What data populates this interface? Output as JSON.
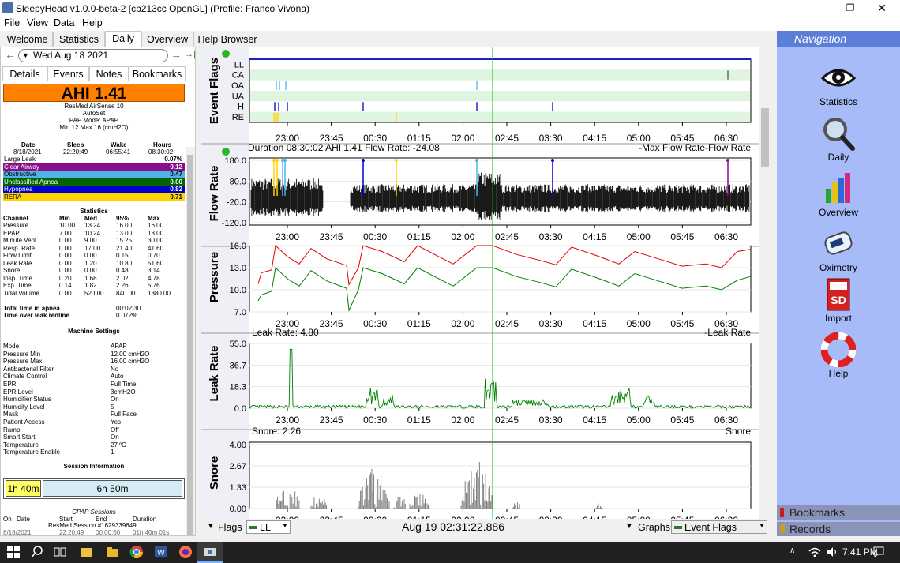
{
  "window": {
    "title": "SleepyHead v1.0.0-beta-2 [cb213cc OpenGL] (Profile: Franco Vivona)",
    "minimize": "—",
    "maximize": "❐",
    "close": "✕"
  },
  "menu": [
    "File",
    "View",
    "Data",
    "Help"
  ],
  "tabs": [
    "Welcome",
    "Statistics",
    "Daily",
    "Overview",
    "Help Browser"
  ],
  "date_nav": {
    "date": "Wed Aug 18 2021",
    "prev": "←",
    "next": "→",
    "last": "→|"
  },
  "subtabs": [
    "Details",
    "Events",
    "Notes",
    "Bookmarks"
  ],
  "ahi": "AHI 1.41",
  "machine": {
    "name": "ResMed AirSense 10",
    "model": "AutoSet",
    "mode": "PAP Mode: APAP",
    "pressure": "Min 12 Max 16 (cmH2O)"
  },
  "session_header": {
    "cols": [
      "Date",
      "Sleep",
      "Wake",
      "Hours"
    ],
    "vals": [
      "8/18/2021",
      "22:20:49",
      "06:55:41",
      "08:30:02"
    ]
  },
  "event_rows": [
    {
      "label": "Large Leak",
      "value": "0.07%",
      "color": "#ffffff",
      "text": "#000000"
    },
    {
      "label": "Clear Airway",
      "value": "0.12",
      "color": "#8a0f8a",
      "text": "#ffffff"
    },
    {
      "label": "Obstructive",
      "value": "0.47",
      "color": "#4fb3e8",
      "text": "#000000"
    },
    {
      "label": "Unclassified Apnea",
      "value": "0.00",
      "color": "#006400",
      "text": "#ffffff"
    },
    {
      "label": "Hypopnea",
      "value": "0.82",
      "color": "#0000cc",
      "text": "#ffffff"
    },
    {
      "label": "RERA",
      "value": "0.71",
      "color": "#ffd400",
      "text": "#000000"
    }
  ],
  "statistics": {
    "title": "Statistics",
    "cols": [
      "Channel",
      "Min",
      "Med",
      "95%",
      "Max"
    ],
    "rows": [
      [
        "Pressure",
        "10.00",
        "13.24",
        "16.00",
        "16.00"
      ],
      [
        "EPAP",
        "7.00",
        "10.24",
        "13.00",
        "13.00"
      ],
      [
        "Minute Vent.",
        "0.00",
        "9.00",
        "15.25",
        "30.00"
      ],
      [
        "Resp. Rate",
        "0.00",
        "17.00",
        "21.40",
        "41.60"
      ],
      [
        "Flow Limit.",
        "0.00",
        "0.00",
        "0.15",
        "0.70"
      ],
      [
        "Leak Rate",
        "0.00",
        "1.20",
        "10.80",
        "51.60"
      ],
      [
        "Snore",
        "0.00",
        "0.00",
        "0.48",
        "3.14"
      ],
      [
        "Insp. Time",
        "0.20",
        "1.68",
        "2.02",
        "4.78"
      ],
      [
        "Exp. Time",
        "0.14",
        "1.82",
        "2.26",
        "5.76"
      ],
      [
        "Tidal Volume",
        "0.00",
        "520.00",
        "840.00",
        "1380.00"
      ]
    ]
  },
  "apnea": [
    {
      "label": "Total time in apnea",
      "value": "00:02:30"
    },
    {
      "label": "Time over leak redline",
      "value": "0.072%"
    }
  ],
  "machine_settings": {
    "title": "Machine Settings",
    "rows": [
      [
        "Mode",
        "APAP"
      ],
      [
        "Pressure Min",
        "12.00 cmH2O"
      ],
      [
        "Pressure Max",
        "16.00 cmH2O"
      ],
      [
        "Antibacterial Filter",
        "No"
      ],
      [
        "Climate Control",
        "Auto"
      ],
      [
        "EPR",
        "Full Time"
      ],
      [
        "EPR Level",
        "3cmH2O"
      ],
      [
        "Humidifier Status",
        "On"
      ],
      [
        "Humidity Level",
        "5"
      ],
      [
        "Mask",
        "Full Face"
      ],
      [
        "Patient Access",
        "Yes"
      ],
      [
        "Ramp",
        "Off"
      ],
      [
        "Smart Start",
        "On"
      ],
      [
        "Temperature",
        "27 ºC"
      ],
      [
        "Temperature Enable",
        "1"
      ]
    ]
  },
  "session_info": {
    "title": "Session Information",
    "bar1": "1h 40m",
    "bar2": "6h 50m",
    "cpap_title": "CPAP Sessions",
    "cols": [
      "On",
      "Date",
      "Start",
      "End",
      "Duration"
    ],
    "row": "ResMed Session #1629339649",
    "row2": [
      "8/18/2021",
      "22:20:49",
      "00:00:50",
      "01h 40m 01s"
    ]
  },
  "time_ticks": [
    "23:00",
    "23:45",
    "00:30",
    "01:15",
    "02:00",
    "02:45",
    "03:30",
    "04:15",
    "05:00",
    "05:45",
    "06:30"
  ],
  "graphs": {
    "event_flags": {
      "title": "Event Flags",
      "labels": [
        "LL",
        "CA",
        "OA",
        "UA",
        "H",
        "RE"
      ]
    },
    "flow_rate": {
      "title": "Flow Rate",
      "header": "Duration 08:30:02 AHI 1.41 Flow Rate: -24.08",
      "legend": "-Max Flow Rate-Flow Rate",
      "ticks": [
        "180.0",
        "80.0",
        "-20.0",
        "-120.0"
      ]
    },
    "pressure": {
      "title": "Pressure",
      "ticks": [
        "16.0",
        "13.0",
        "10.0",
        "7.0"
      ]
    },
    "leak_rate": {
      "title": "Leak Rate",
      "header": "Leak Rate: 4.80",
      "legend": "-Leak Rate",
      "ticks": [
        "55.0",
        "36.7",
        "18.3",
        "0.0"
      ]
    },
    "snore": {
      "title": "Snore",
      "header": "Snore: 2.26",
      "legend": "Snore",
      "ticks": [
        "4.00",
        "2.67",
        "1.33",
        "0.00"
      ]
    }
  },
  "bottom": {
    "flags": "Flags",
    "ll": "LL",
    "time": "Aug 19 02:31:22.886",
    "graphs": "Graphs",
    "event_flags": "Event Flags"
  },
  "navigation": {
    "title": "Navigation",
    "items": [
      "Statistics",
      "Daily",
      "Overview",
      "Oximetry",
      "Import",
      "Help"
    ],
    "bookmarks": "Bookmarks",
    "records": "Records"
  },
  "taskbar": {
    "time": "7:41 PM"
  },
  "colors": {
    "ahi": "#ff8000",
    "nav_bg": "#a6bbf7",
    "pressure_red": "#e00000",
    "pressure_green": "#008000",
    "cursor": "#00cc00"
  }
}
